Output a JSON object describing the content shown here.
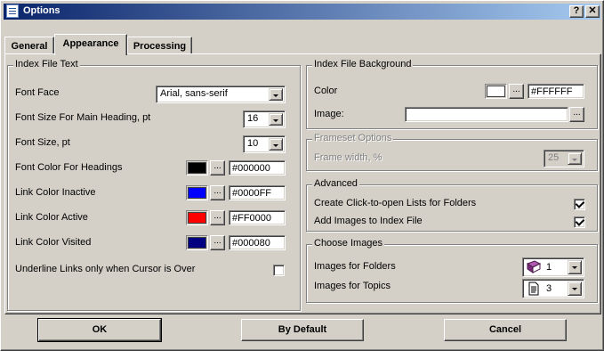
{
  "window": {
    "title": "Options"
  },
  "titlebar": {
    "help_label": "?",
    "close_label": "✕"
  },
  "tabs": [
    {
      "label": "General"
    },
    {
      "label": "Appearance"
    },
    {
      "label": "Processing"
    }
  ],
  "index_file_text": {
    "legend": "Index File Text",
    "font_face": {
      "label": "Font Face",
      "value": "Arial, sans-serif"
    },
    "font_size_main": {
      "label": "Font Size For Main Heading, pt",
      "value": "16"
    },
    "font_size": {
      "label": "Font Size, pt",
      "value": "10"
    },
    "color_headings": {
      "label": "Font Color For Headings",
      "hex": "#000000",
      "color": "#000000"
    },
    "link_inactive": {
      "label": "Link Color Inactive",
      "hex": "#0000FF",
      "color": "#0000FF"
    },
    "link_active": {
      "label": "Link Color Active",
      "hex": "#FF0000",
      "color": "#FF0000"
    },
    "link_visited": {
      "label": "Link Color Visited",
      "hex": "#000080",
      "color": "#000080"
    },
    "underline": {
      "label": "Underline Links only when Cursor is Over",
      "checked": false
    }
  },
  "index_file_background": {
    "legend": "Index File Background",
    "color": {
      "label": "Color",
      "hex": "#FFFFFF",
      "color": "#FFFFFF"
    },
    "image": {
      "label": "Image:",
      "value": ""
    }
  },
  "frameset_options": {
    "legend": "Frameset Options",
    "frame_width": {
      "label": "Frame width, %",
      "value": "25",
      "disabled": true
    }
  },
  "advanced": {
    "legend": "Advanced",
    "click_to_open": {
      "label": "Create Click-to-open Lists for Folders",
      "checked": true
    },
    "add_images": {
      "label": "Add Images to Index File",
      "checked": true
    }
  },
  "choose_images": {
    "legend": "Choose Images",
    "folders": {
      "label": "Images for Folders",
      "value": "1",
      "icon": "book-icon"
    },
    "topics": {
      "label": "Images for Topics",
      "value": "3",
      "icon": "page-icon"
    }
  },
  "buttons": {
    "ok": "OK",
    "default": "By Default",
    "cancel": "Cancel"
  },
  "dots_label": "..."
}
